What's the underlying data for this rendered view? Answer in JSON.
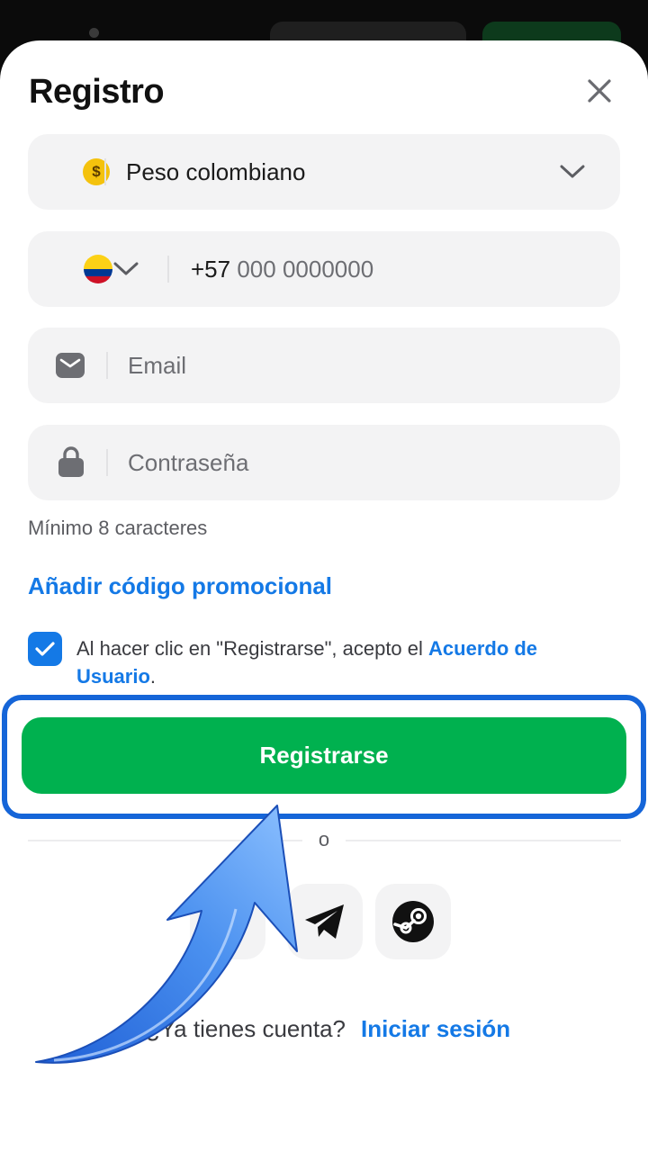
{
  "header": {
    "title": "Registro"
  },
  "currency": {
    "label": "Peso colombiano",
    "icon": "dollar-coin-icon",
    "symbol": "$"
  },
  "phone": {
    "country": "Colombia",
    "prefix": "+57",
    "placeholder": "000 0000000"
  },
  "email": {
    "placeholder": "Email"
  },
  "password": {
    "placeholder": "Contraseña",
    "hint": "Mínimo 8 caracteres"
  },
  "promo": {
    "label": "Añadir código promocional"
  },
  "terms": {
    "checked": true,
    "text": "Al hacer clic en \"Registrarse\", acepto el ",
    "link": "Acuerdo de Usuario",
    "end": "."
  },
  "register_button": {
    "label": "Registrarse"
  },
  "divider": {
    "label": "o"
  },
  "social": [
    {
      "name": "telegram"
    },
    {
      "name": "steam"
    }
  ],
  "login": {
    "prompt": "¿Ya tienes cuenta?",
    "link": "Iniciar sesión"
  },
  "colors": {
    "accent": "#1479e6",
    "button": "#00b14f",
    "highlight": "#1565d8",
    "arrow": "#3f86ec"
  }
}
